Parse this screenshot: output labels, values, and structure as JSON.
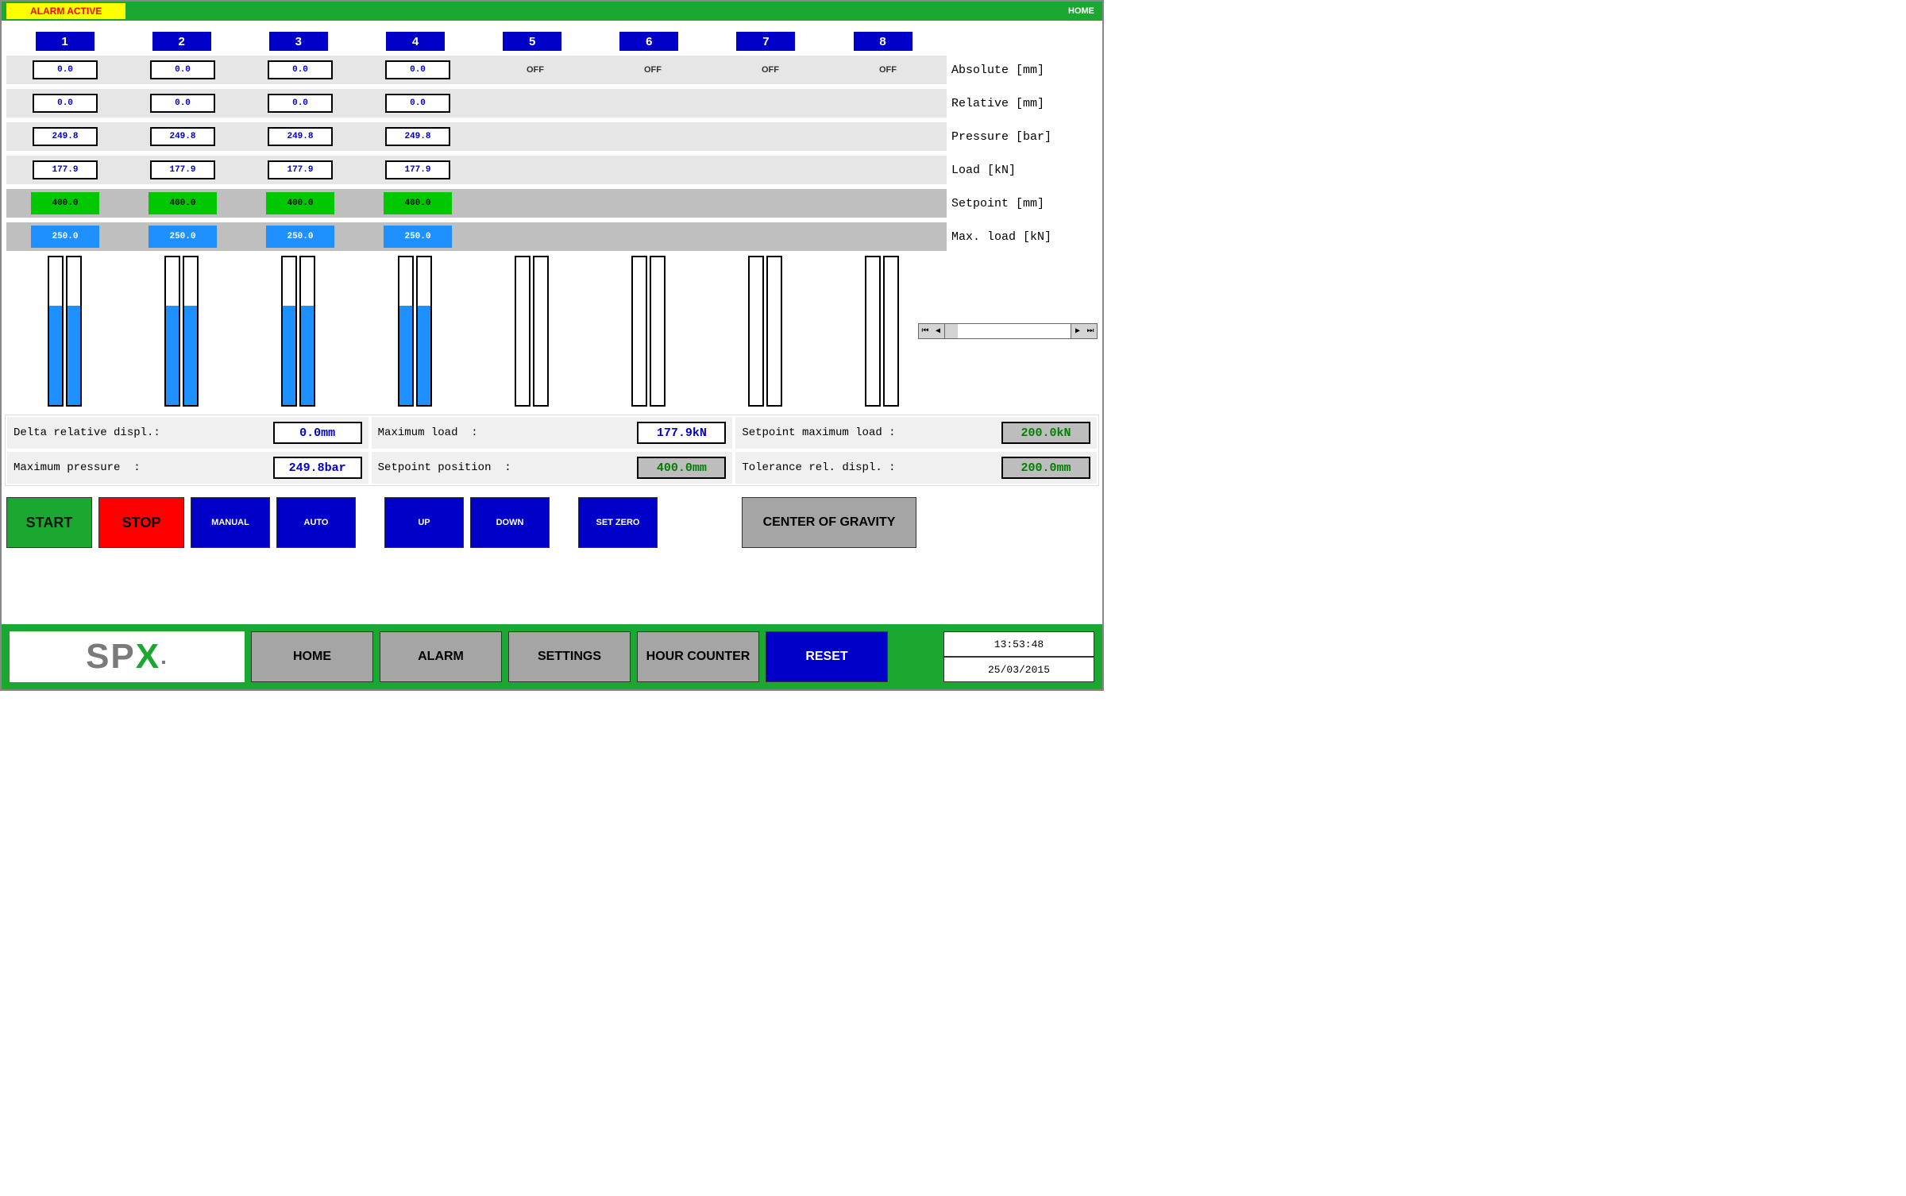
{
  "topbar": {
    "alarm": "ALARM ACTIVE",
    "home": "HOME"
  },
  "channels": [
    {
      "num": "1",
      "active": true,
      "absolute": "0.0",
      "relative": "0.0",
      "pressure": "249.8",
      "load": "177.9",
      "setpoint": "400.0",
      "maxload": "250.0",
      "bar1_pct": 67,
      "bar2_pct": 67
    },
    {
      "num": "2",
      "active": true,
      "absolute": "0.0",
      "relative": "0.0",
      "pressure": "249.8",
      "load": "177.9",
      "setpoint": "400.0",
      "maxload": "250.0",
      "bar1_pct": 67,
      "bar2_pct": 67
    },
    {
      "num": "3",
      "active": true,
      "absolute": "0.0",
      "relative": "0.0",
      "pressure": "249.8",
      "load": "177.9",
      "setpoint": "400.0",
      "maxload": "250.0",
      "bar1_pct": 67,
      "bar2_pct": 67
    },
    {
      "num": "4",
      "active": true,
      "absolute": "0.0",
      "relative": "0.0",
      "pressure": "249.8",
      "load": "177.9",
      "setpoint": "400.0",
      "maxload": "250.0",
      "bar1_pct": 67,
      "bar2_pct": 67
    },
    {
      "num": "5",
      "active": false,
      "absolute": "OFF"
    },
    {
      "num": "6",
      "active": false,
      "absolute": "OFF"
    },
    {
      "num": "7",
      "active": false,
      "absolute": "OFF"
    },
    {
      "num": "8",
      "active": false,
      "absolute": "OFF"
    }
  ],
  "row_labels": {
    "absolute": "Absolute [mm]",
    "relative": "Relative [mm]",
    "pressure": "Pressure [bar]",
    "load": "Load [kN]",
    "setpoint": "Setpoint [mm]",
    "maxload": "Max. load [kN]"
  },
  "summary": {
    "delta_rel_label": "Delta relative displ.:",
    "delta_rel_val": "0.0mm",
    "max_load_label": "Maximum load",
    "max_load_val": "177.9kN",
    "sp_max_load_label": "Setpoint maximum load :",
    "sp_max_load_val": "200.0kN",
    "max_press_label": "Maximum pressure",
    "max_press_val": "249.8bar",
    "sp_pos_label": "Setpoint position",
    "sp_pos_val": "400.0mm",
    "tol_rel_label": "Tolerance rel. displ. :",
    "tol_rel_val": "200.0mm"
  },
  "controls": {
    "start": "START",
    "stop": "STOP",
    "manual": "MANUAL",
    "auto": "AUTO",
    "up": "UP",
    "down": "DOWN",
    "set_zero": "SET ZERO",
    "cog": "CENTER OF GRAVITY"
  },
  "bottom": {
    "logo_sp": "SP",
    "logo_x": "X",
    "logo_dot": ".",
    "home": "HOME",
    "alarm": "ALARM",
    "settings": "SETTINGS",
    "hour_counter": "HOUR COUNTER",
    "reset": "RESET",
    "time": "13:53:48",
    "date": "25/03/2015"
  }
}
